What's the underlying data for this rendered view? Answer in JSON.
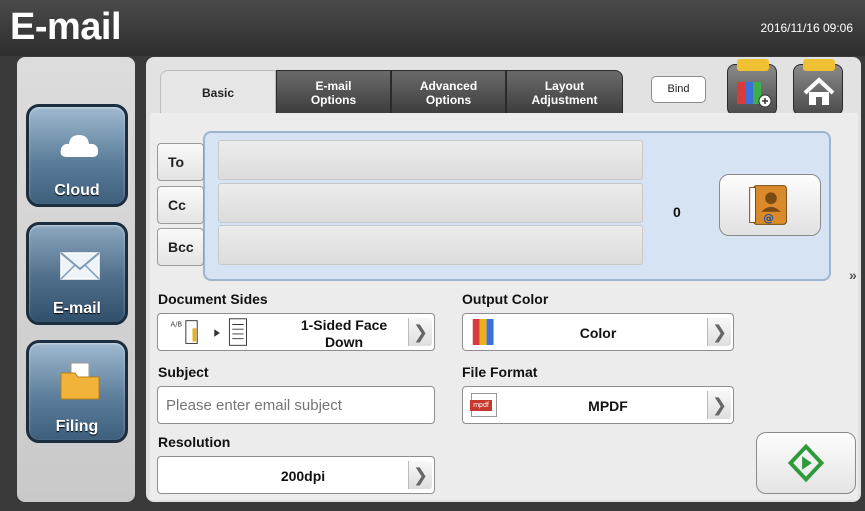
{
  "header": {
    "title": "E-mail",
    "datetime": "2016/11/16 09:06"
  },
  "nav": {
    "items": [
      {
        "label": "Cloud",
        "icon": "cloud-icon"
      },
      {
        "label": "E-mail",
        "icon": "envelope-icon"
      },
      {
        "label": "Filing",
        "icon": "folder-icon"
      }
    ]
  },
  "tabs": [
    {
      "label": "Basic"
    },
    {
      "label": "E-mail Options"
    },
    {
      "label": "Advanced Options"
    },
    {
      "label": "Layout Adjustment"
    }
  ],
  "toolbar": {
    "bind_label": "Bind"
  },
  "recipients": {
    "to_label": "To",
    "cc_label": "Cc",
    "bcc_label": "Bcc",
    "count": "0"
  },
  "more_label": "»",
  "document_sides": {
    "label": "Document Sides",
    "value_line1": "1-Sided Face",
    "value_line2": "Down"
  },
  "output_color": {
    "label": "Output Color",
    "value": "Color"
  },
  "subject": {
    "label": "Subject",
    "placeholder": "Please enter email subject"
  },
  "file_format": {
    "label": "File Format",
    "value": "MPDF",
    "icon_text": "mpdf"
  },
  "resolution": {
    "label": "Resolution",
    "value": "200dpi"
  },
  "colors": {
    "accent": "#2e9a3a",
    "nav_blue": "#5d7f9b",
    "recipient_bg": "#d5e3f2"
  }
}
